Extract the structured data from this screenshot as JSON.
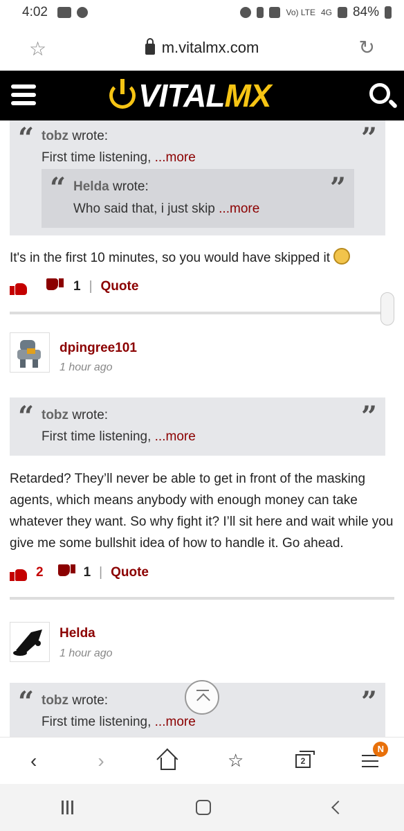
{
  "status_bar": {
    "time": "4:02",
    "battery": "84%",
    "network": "4G",
    "volte": "Vo) LTE"
  },
  "browser": {
    "url": "m.vitalmx.com"
  },
  "site": {
    "logo_vital": "VITAL",
    "logo_mx": "MX"
  },
  "posts": [
    {
      "quote": {
        "author": "tobz",
        "wrote": "wrote:",
        "text": "First time listening,",
        "more": "...more"
      },
      "nested_quote": {
        "author": "Helda",
        "wrote": "wrote:",
        "text": "Who said that, i just skip",
        "more": "...more"
      },
      "body": "It's in the first 10 minutes, so you would have skipped it",
      "likes": "",
      "dislikes": "1",
      "quote_label": "Quote"
    },
    {
      "username": "dpingree101",
      "time": "1 hour ago",
      "quote": {
        "author": "tobz",
        "wrote": "wrote:",
        "text": "First time listening,",
        "more": "...more"
      },
      "body": "Retarded? They’ll never be able to get in front of the masking agents, which means anybody with enough money can take whatever they want. So why fight it? I’ll sit here and wait while you give me some bullshit idea of how to handle it. Go ahead.",
      "likes": "2",
      "dislikes": "1",
      "quote_label": "Quote"
    },
    {
      "username": "Helda",
      "time": "1 hour ago",
      "quote": {
        "author": "tobz",
        "wrote": "wrote:",
        "text": "First time listening,",
        "more": "...more"
      }
    }
  ],
  "toolbar": {
    "tabs_count": "2",
    "menu_badge": "N"
  },
  "icons": {
    "accent": "#8b0000",
    "brand_yellow": "#f6c414"
  }
}
